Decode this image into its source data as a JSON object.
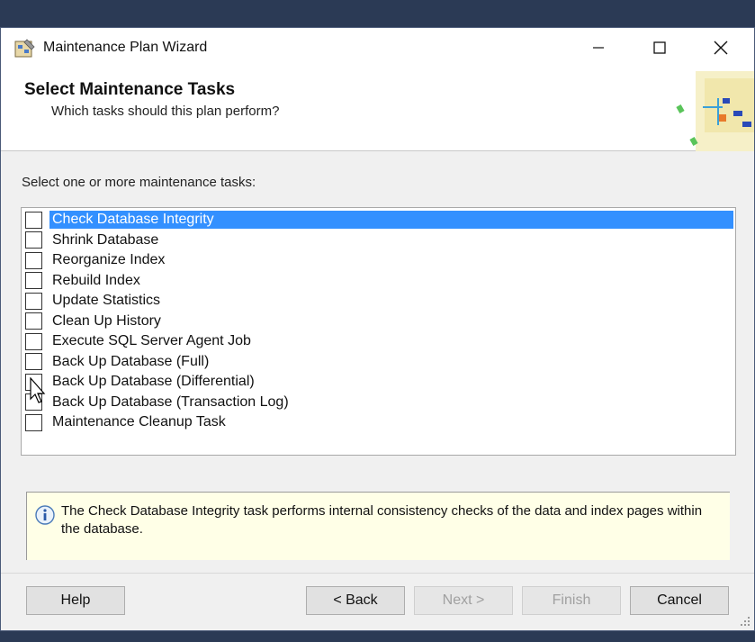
{
  "window": {
    "title": "Maintenance Plan Wizard",
    "minimize_glyph": "—",
    "maximize_glyph": "☐",
    "close_glyph": "✕"
  },
  "header": {
    "title": "Select Maintenance Tasks",
    "subtitle": "Which tasks should this plan perform?"
  },
  "main": {
    "prompt": "Select one or more maintenance tasks:",
    "tasks": [
      {
        "label": "Check Database Integrity",
        "checked": false,
        "selected": true
      },
      {
        "label": "Shrink Database",
        "checked": false,
        "selected": false
      },
      {
        "label": "Reorganize Index",
        "checked": false,
        "selected": false
      },
      {
        "label": "Rebuild Index",
        "checked": false,
        "selected": false
      },
      {
        "label": "Update Statistics",
        "checked": false,
        "selected": false
      },
      {
        "label": "Clean Up History",
        "checked": false,
        "selected": false
      },
      {
        "label": "Execute SQL Server Agent Job",
        "checked": false,
        "selected": false
      },
      {
        "label": "Back Up Database (Full)",
        "checked": false,
        "selected": false
      },
      {
        "label": "Back Up Database (Differential)",
        "checked": false,
        "selected": false
      },
      {
        "label": "Back Up Database (Transaction Log)",
        "checked": false,
        "selected": false
      },
      {
        "label": "Maintenance Cleanup Task",
        "checked": false,
        "selected": false
      }
    ],
    "description": "The Check Database Integrity task performs internal consistency checks of the data and index pages within the database."
  },
  "footer": {
    "help": "Help",
    "back": "< Back",
    "next": "Next >",
    "finish": "Finish",
    "cancel": "Cancel"
  },
  "colors": {
    "selection": "#3390ff",
    "info_background": "#ffffe7"
  },
  "icons": {
    "app": "maintenance-plan-icon",
    "info": "info-icon",
    "cursor": "mouse-pointer-icon"
  }
}
